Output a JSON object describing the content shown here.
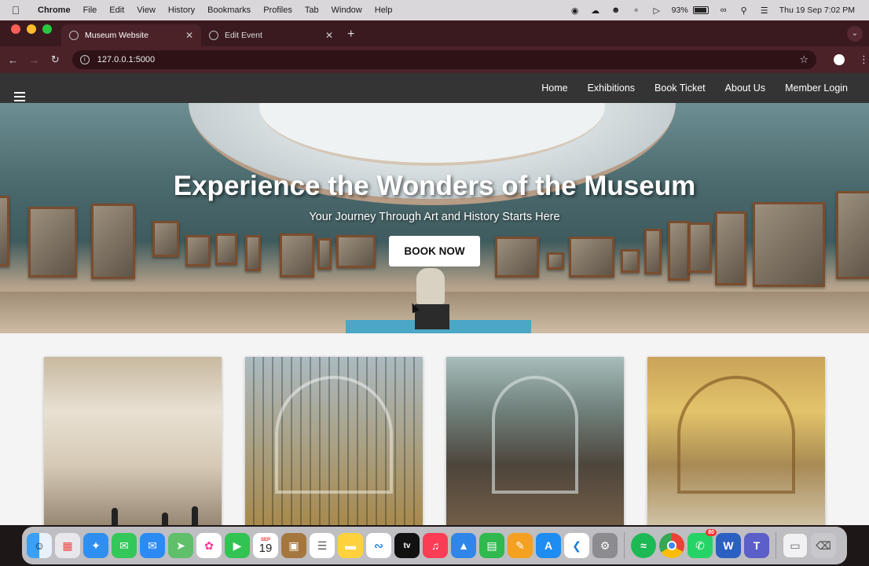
{
  "menubar": {
    "app": "Chrome",
    "items": [
      "File",
      "Edit",
      "View",
      "History",
      "Bookmarks",
      "Profiles",
      "Tab",
      "Window",
      "Help"
    ],
    "battery": "93%",
    "datetime": "Thu 19 Sep  7:02 PM"
  },
  "browser": {
    "tabs": [
      {
        "title": "Museum Website",
        "active": true
      },
      {
        "title": "Edit Event",
        "active": false
      }
    ],
    "url": "127.0.0.1:5000"
  },
  "site": {
    "nav": [
      "Home",
      "Exhibitions",
      "Book Ticket",
      "About Us",
      "Member Login"
    ],
    "hero": {
      "title": "Experience the Wonders of the Museum",
      "subtitle": "Your Journey Through Art and History Starts Here",
      "cta": "BOOK NOW"
    }
  },
  "dock": {
    "calendar_month": "SEP",
    "calendar_day": "19",
    "whatsapp_badge": "80",
    "apps": [
      "finder",
      "launchpad",
      "safari",
      "messages",
      "mail",
      "maps",
      "photos",
      "facetime",
      "calendar",
      "notes-brown",
      "reminders",
      "notes",
      "freeform",
      "apple-tv",
      "music",
      "keynote",
      "numbers",
      "pages",
      "app-store",
      "vscode",
      "system-settings",
      "spotify",
      "chrome",
      "whatsapp",
      "word",
      "teams",
      "finder-window",
      "trash"
    ]
  }
}
